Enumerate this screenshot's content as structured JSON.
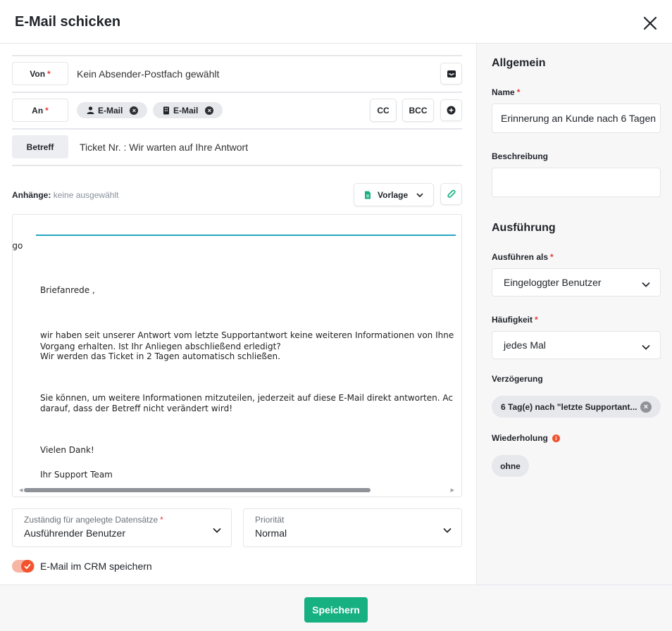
{
  "header": {
    "title": "E-Mail schicken"
  },
  "from": {
    "label": "Von",
    "value": "Kein Absender-Postfach gewählt"
  },
  "to": {
    "label": "An",
    "recipients": [
      {
        "icon": "person-icon",
        "label": "E-Mail"
      },
      {
        "icon": "building-icon",
        "label": "E-Mail"
      }
    ],
    "cc_label": "CC",
    "bcc_label": "BCC"
  },
  "subject": {
    "label": "Betreff",
    "value": "Ticket Nr. : Wir warten auf Ihre Antwort"
  },
  "attachments": {
    "label": "Anhänge:",
    "value": "keine ausgewählt",
    "template_label": "Vorlage"
  },
  "editor": {
    "logo": "Logo",
    "lines": [
      "Briefanrede ,",
      "wir haben seit unserer Antwort vom letzte Supportantwort keine weiteren Informationen von Ihne",
      "Vorgang erhalten. Ist Ihr Anliegen abschließend erledigt?",
      "Wir werden das Ticket in 2 Tagen automatisch schließen.",
      "Sie können, um weitere Informationen mitzuteilen, jederzeit auf diese E-Mail direkt antworten. Ac",
      "darauf, dass der Betreff nicht verändert wird!",
      "Vielen Dank!",
      "Ihr Support Team"
    ]
  },
  "responsible": {
    "label": "Zuständig für angelegte Datensätze",
    "value": "Ausführender Benutzer"
  },
  "priority": {
    "label": "Priorität",
    "value": "Normal"
  },
  "save_crm": {
    "label": "E-Mail im CRM speichern",
    "checked": true
  },
  "footer": {
    "save_label": "Speichern"
  },
  "sidebar": {
    "general_title": "Allgemein",
    "name_label": "Name",
    "name_value": "Erinnerung an Kunde nach 6 Tagen",
    "description_label": "Beschreibung",
    "description_value": "",
    "execution_title": "Ausführung",
    "execute_as_label": "Ausführen als",
    "execute_as_value": "Eingeloggter Benutzer",
    "frequency_label": "Häufigkeit",
    "frequency_value": "jedes Mal",
    "delay_label": "Verzögerung",
    "delay_value": "6 Tag(e) nach \"letzte Supportant...",
    "repeat_label": "Wiederholung",
    "repeat_value": "ohne"
  },
  "colors": {
    "accent_green": "#16b081",
    "required_red": "#e53935",
    "toggle_orange": "#f2522e",
    "logo_line": "#26a6c2"
  }
}
